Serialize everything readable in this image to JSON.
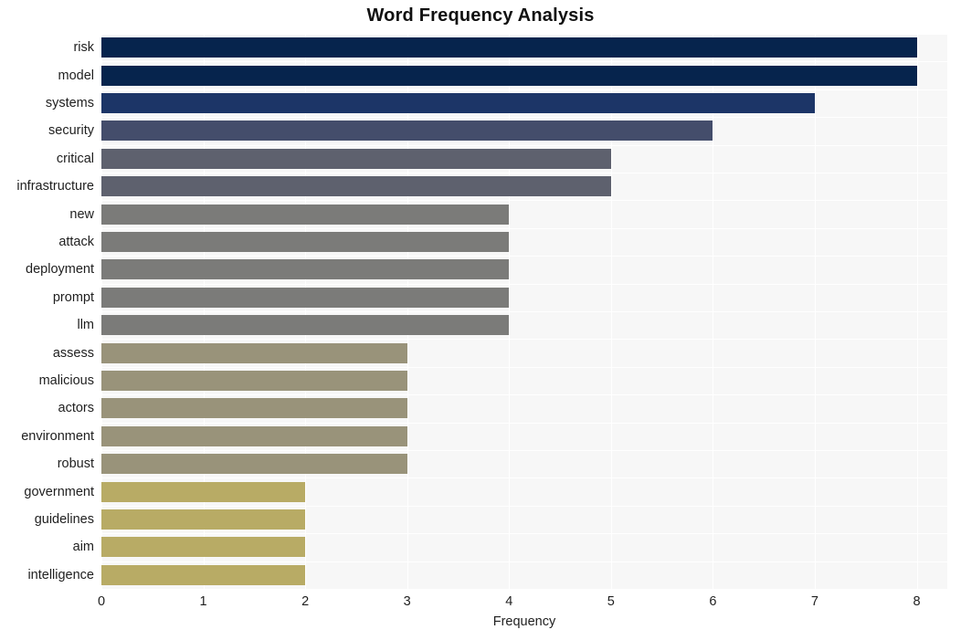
{
  "chart_data": {
    "type": "bar",
    "orientation": "horizontal",
    "title": "Word Frequency Analysis",
    "xlabel": "Frequency",
    "ylabel": "",
    "xlim": [
      0,
      8.3
    ],
    "xticks": [
      0,
      1,
      2,
      3,
      4,
      5,
      6,
      7,
      8
    ],
    "xtick_labels": [
      "0",
      "1",
      "2",
      "3",
      "4",
      "5",
      "6",
      "7",
      "8"
    ],
    "grid": true,
    "legend": null,
    "plot_background": "#f7f7f7",
    "grid_color": "#ffffff",
    "categories": [
      "risk",
      "model",
      "systems",
      "security",
      "critical",
      "infrastructure",
      "new",
      "attack",
      "deployment",
      "prompt",
      "llm",
      "assess",
      "malicious",
      "actors",
      "environment",
      "robust",
      "government",
      "guidelines",
      "aim",
      "intelligence"
    ],
    "values": [
      8,
      8,
      7,
      6,
      5,
      5,
      4,
      4,
      4,
      4,
      4,
      3,
      3,
      3,
      3,
      3,
      2,
      2,
      2,
      2
    ],
    "bar_colors": [
      "#06244d",
      "#06244d",
      "#1c3567",
      "#444d6b",
      "#5e616e",
      "#5e616e",
      "#7b7b79",
      "#7b7b79",
      "#7b7b79",
      "#7b7b79",
      "#7b7b79",
      "#99937a",
      "#99937a",
      "#99937a",
      "#99937a",
      "#99937a",
      "#b8ab65",
      "#b8ab65",
      "#b8ab65",
      "#b8ab65"
    ],
    "bars": [
      {
        "label": "risk",
        "value": 8,
        "color": "#06244d"
      },
      {
        "label": "model",
        "value": 8,
        "color": "#06244d"
      },
      {
        "label": "systems",
        "value": 7,
        "color": "#1c3567"
      },
      {
        "label": "security",
        "value": 6,
        "color": "#444d6b"
      },
      {
        "label": "critical",
        "value": 5,
        "color": "#5e616e"
      },
      {
        "label": "infrastructure",
        "value": 5,
        "color": "#5e616e"
      },
      {
        "label": "new",
        "value": 4,
        "color": "#7b7b79"
      },
      {
        "label": "attack",
        "value": 4,
        "color": "#7b7b79"
      },
      {
        "label": "deployment",
        "value": 4,
        "color": "#7b7b79"
      },
      {
        "label": "prompt",
        "value": 4,
        "color": "#7b7b79"
      },
      {
        "label": "llm",
        "value": 4,
        "color": "#7b7b79"
      },
      {
        "label": "assess",
        "value": 3,
        "color": "#99937a"
      },
      {
        "label": "malicious",
        "value": 3,
        "color": "#99937a"
      },
      {
        "label": "actors",
        "value": 3,
        "color": "#99937a"
      },
      {
        "label": "environment",
        "value": 3,
        "color": "#99937a"
      },
      {
        "label": "robust",
        "value": 3,
        "color": "#99937a"
      },
      {
        "label": "government",
        "value": 2,
        "color": "#b8ab65"
      },
      {
        "label": "guidelines",
        "value": 2,
        "color": "#b8ab65"
      },
      {
        "label": "aim",
        "value": 2,
        "color": "#b8ab65"
      },
      {
        "label": "intelligence",
        "value": 2,
        "color": "#b8ab65"
      }
    ]
  }
}
